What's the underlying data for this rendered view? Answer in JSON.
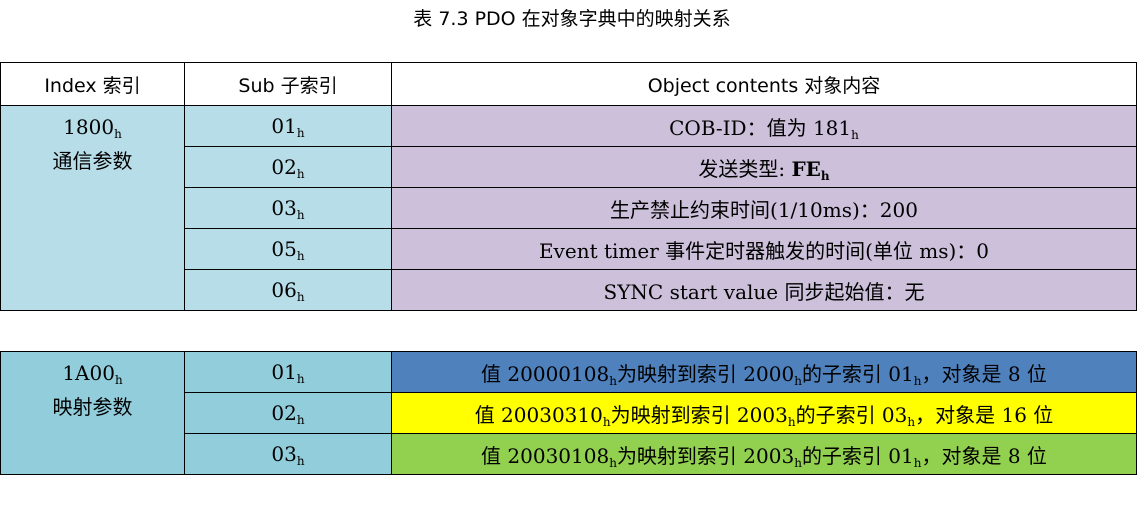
{
  "caption": "表 7.3 PDO 在对象字典中的映射关系",
  "headers": {
    "index": "Index 索引",
    "sub": "Sub 子索引",
    "contents": "Object contents 对象内容"
  },
  "group1": {
    "index": "1800",
    "index_sub": "h",
    "name": "通信参数",
    "rows": [
      {
        "sub": "01",
        "content_a": "COB-ID：值为 181",
        "content_a_sub": "h"
      },
      {
        "sub": "02",
        "content_a": "发送类型: ",
        "content_b": "FE",
        "content_b_sub": "h"
      },
      {
        "sub": "03",
        "content_a": "生产禁止约束时间(1/10ms)：200"
      },
      {
        "sub": "05",
        "content_a": "Event timer 事件定时器触发的时间(单位 ms)：0"
      },
      {
        "sub": "06",
        "content_a": "SYNC start value 同步起始值：无"
      }
    ]
  },
  "group2": {
    "index": "1A00",
    "index_sub": "h",
    "name": "映射参数",
    "rows": [
      {
        "sub": "01",
        "p1": "值 20000108",
        "p2": "为映射到索引 2000",
        "p3": "的子索引 01",
        "p4": "，对象是 8 位",
        "color": "#4f81bd"
      },
      {
        "sub": "02",
        "p1": "值 20030310",
        "p2": "为映射到索引 2003",
        "p3": "的子索引 03",
        "p4": "，对象是 16 位",
        "color": "#ffff00"
      },
      {
        "sub": "03",
        "p1": "值 20030108",
        "p2": "为映射到索引 2003",
        "p3": "的子索引 01",
        "p4": "，对象是 8 位",
        "color": "#92d050"
      }
    ]
  },
  "hex_suffix": "h"
}
